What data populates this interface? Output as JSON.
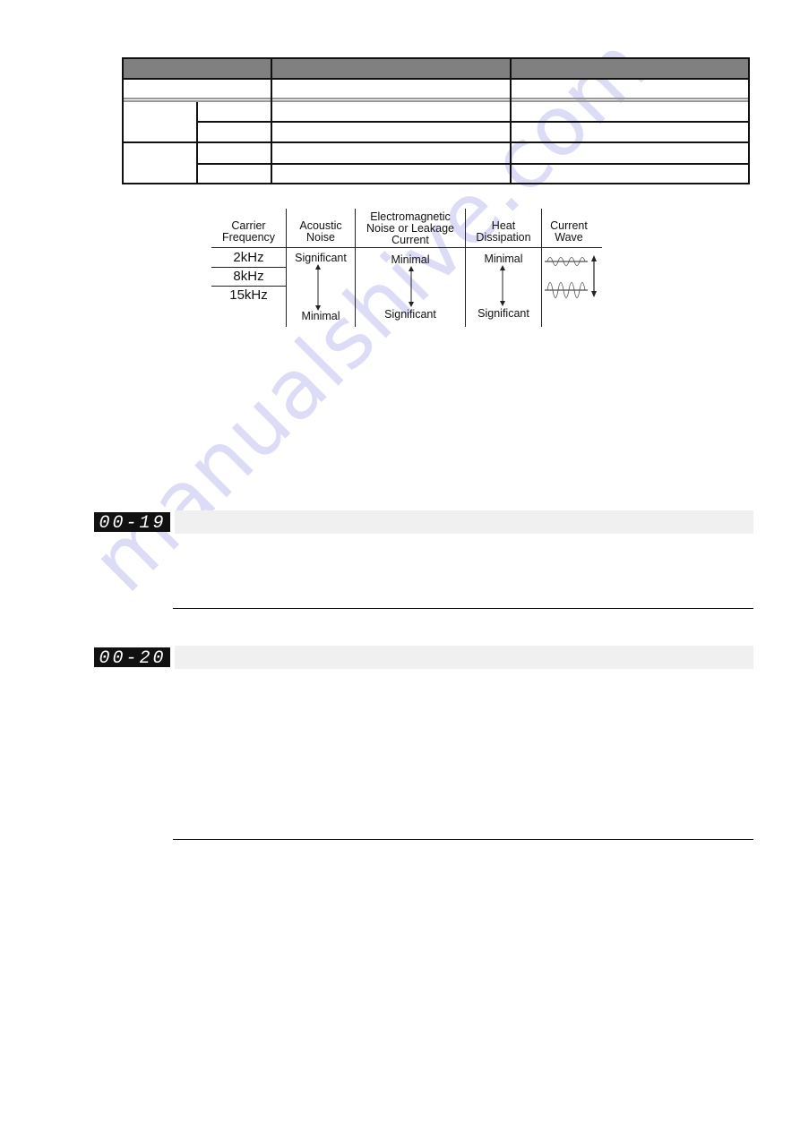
{
  "table": {
    "header": [
      "",
      "",
      ""
    ],
    "rows": [
      [
        "",
        "",
        ""
      ],
      [
        "",
        "",
        "",
        ""
      ],
      [
        "",
        "",
        ""
      ],
      [
        "",
        "",
        "",
        ""
      ],
      [
        "",
        "",
        ""
      ]
    ]
  },
  "carrier_diagram": {
    "headers": {
      "carrier_frequency": [
        "Carrier",
        "Frequency"
      ],
      "acoustic_noise": [
        "Acoustic",
        "Noise"
      ],
      "em_noise": [
        "Electromagnetic",
        "Noise or Leakage",
        "Current"
      ],
      "heat": [
        "Heat",
        "Dissipation"
      ],
      "current_wave": [
        "Current",
        "Wave"
      ]
    },
    "frequencies": [
      "2kHz",
      "8kHz",
      "15kHz"
    ],
    "acoustic_noise": {
      "top": "Significant",
      "bottom": "Minimal"
    },
    "em_noise": {
      "top": "Minimal",
      "bottom": "Significant"
    },
    "heat": {
      "top": "Minimal",
      "bottom": "Significant"
    }
  },
  "parameters": [
    {
      "code": "00-19",
      "title": ""
    },
    {
      "code": "00-20",
      "title": ""
    }
  ],
  "watermark": "manualshive.com"
}
